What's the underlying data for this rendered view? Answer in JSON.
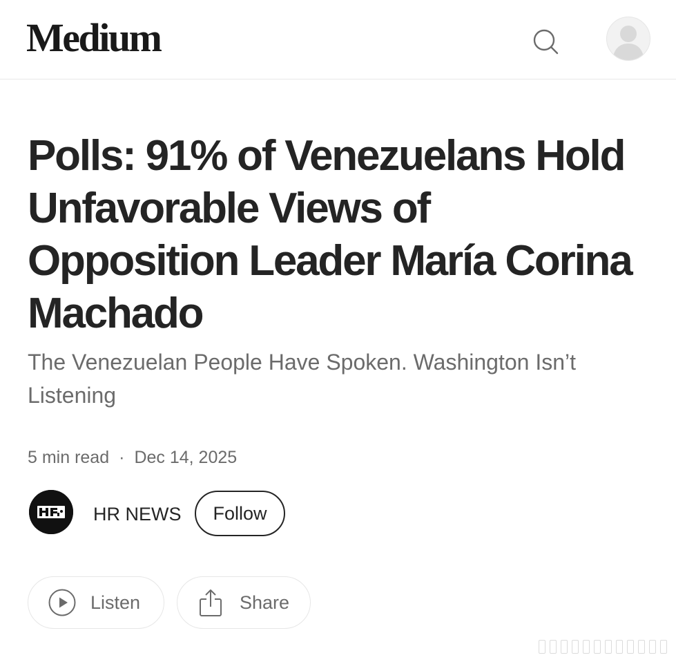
{
  "header": {
    "logo": "Medium",
    "search_icon": "search-icon",
    "avatar_icon": "user-avatar-icon"
  },
  "article": {
    "title": "Polls: 91% of Venezuelans Hold Unfavorable Views of Opposition Leader María Corina Machado",
    "subtitle": "The Venezuelan People Have Spoken. Washington Isn’t Listening",
    "read_time": "5 min read",
    "separator": "·",
    "date": "Dec 14, 2025"
  },
  "publication": {
    "name": "HR NEWS",
    "follow_label": "Follow"
  },
  "actions": {
    "listen_label": "Listen",
    "listen_icon": "play-circle-icon",
    "share_label": "Share",
    "share_icon": "share-icon"
  },
  "colors": {
    "text_primary": "#242424",
    "text_secondary": "#6b6b6b",
    "border": "#e6e6e6",
    "background": "#ffffff"
  }
}
